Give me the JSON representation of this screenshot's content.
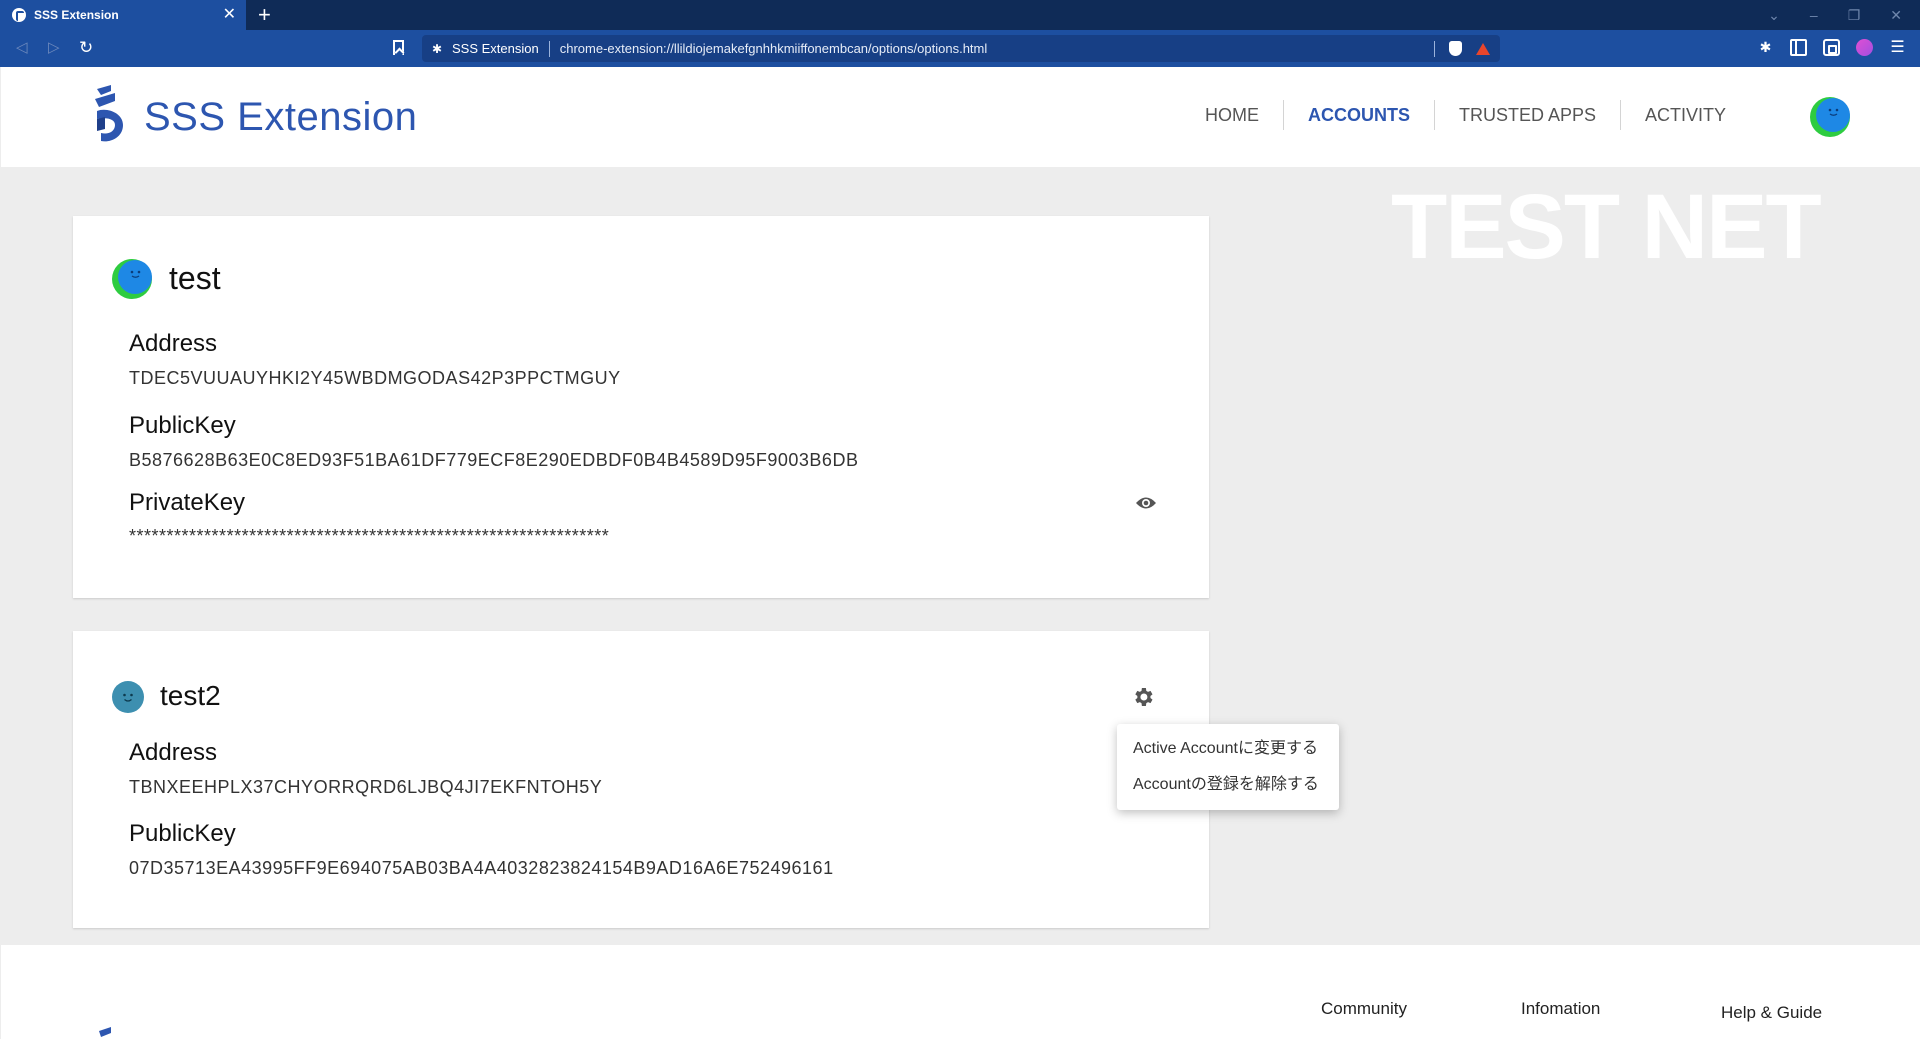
{
  "browser": {
    "tab_title": "SSS Extension",
    "tab_close": "✕",
    "new_tab": "+",
    "omnibox_site": "SSS Extension",
    "url": "chrome-extension://llildiojemakefgnhhkmiiffonembcan/options/options.html",
    "window_controls": [
      "⌄",
      "–",
      "❐",
      "✕"
    ]
  },
  "header": {
    "brand": "SSS Extension",
    "nav": [
      {
        "label": "HOME",
        "active": false
      },
      {
        "label": "ACCOUNTS",
        "active": true
      },
      {
        "label": "TRUSTED APPS",
        "active": false
      },
      {
        "label": "ACTIVITY",
        "active": false
      }
    ]
  },
  "watermark": "TEST NET",
  "accounts": [
    {
      "name": "test",
      "address_label": "Address",
      "address": "TDEC5VUUAUYHKI2Y45WBDMGODAS42P3PPCTMGUY",
      "publickey_label": "PublicKey",
      "publickey": "B5876628B63E0C8ED93F51BA61DF779ECF8E290EDBDF0B4B4589D95F9003B6DB",
      "privatekey_label": "PrivateKey",
      "privatekey_masked": "****************************************************************"
    },
    {
      "name": "test2",
      "address_label": "Address",
      "address": "TBNXEEHPLX37CHYORRQRD6LJBQ4JI7EKFNTOH5Y",
      "publickey_label": "PublicKey",
      "publickey": "07D35713EA43995FF9E694075AB03BA4A4032823824154B9AD16A6E752496161"
    }
  ],
  "context_menu": {
    "items": [
      "Active Accountに変更する",
      "Accountの登録を解除する"
    ]
  },
  "footer": {
    "links": [
      "Community",
      "Infomation",
      "Help & Guide"
    ]
  },
  "colors": {
    "brand": "#2d56b0",
    "tabbar": "#0f2b57",
    "toolbar": "#1d4fa0",
    "page_bg": "#ededed",
    "avatar_blue": "#1e88e5",
    "avatar_green": "#2ecc40",
    "avatar2": "#3d8fb0"
  }
}
